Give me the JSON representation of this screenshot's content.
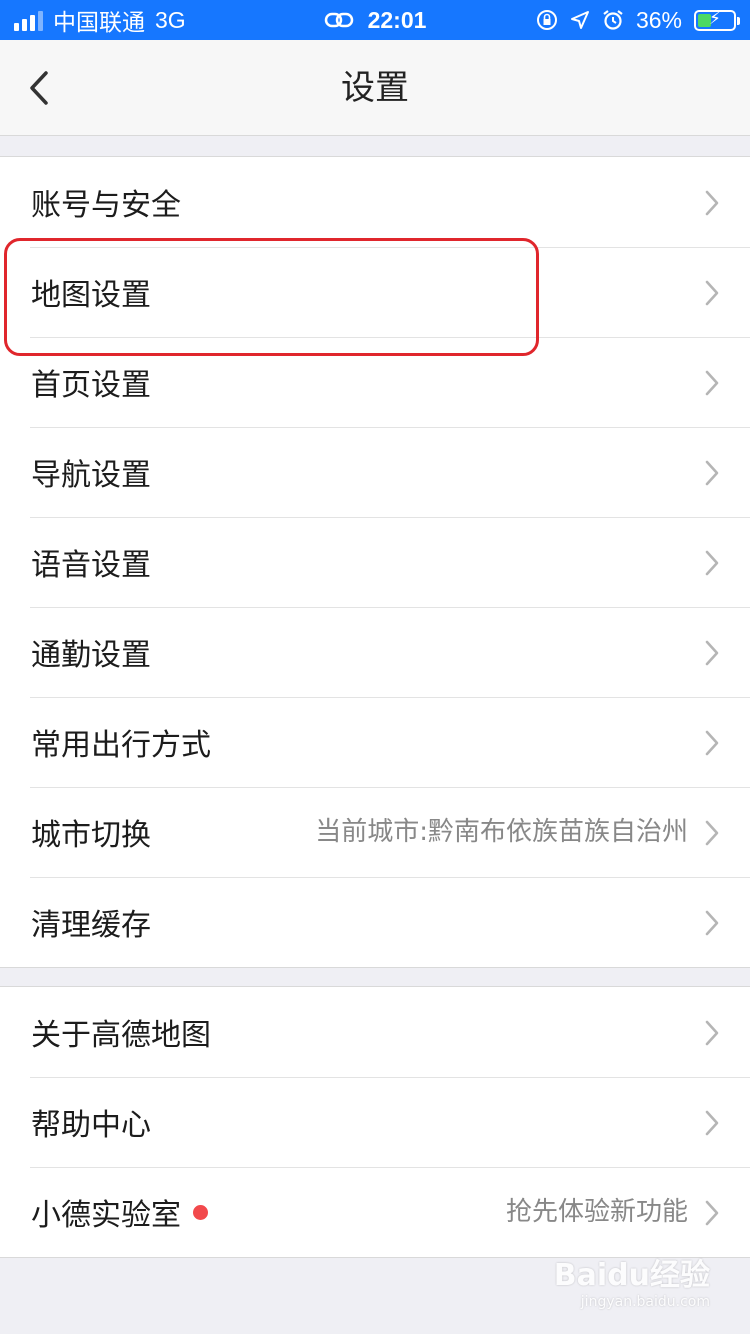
{
  "status_bar": {
    "carrier": "中国联通",
    "network": "3G",
    "time": "22:01",
    "battery": "36%",
    "battery_level": 0.36
  },
  "nav": {
    "title": "设置",
    "back_icon": "chevron-left-icon"
  },
  "group1": [
    {
      "label": "账号与安全",
      "value": ""
    },
    {
      "label": "地图设置",
      "value": ""
    },
    {
      "label": "首页设置",
      "value": ""
    },
    {
      "label": "导航设置",
      "value": ""
    },
    {
      "label": "语音设置",
      "value": ""
    },
    {
      "label": "通勤设置",
      "value": ""
    },
    {
      "label": "常用出行方式",
      "value": ""
    },
    {
      "label": "城市切换",
      "value": "当前城市:黔南布依族苗族自治州"
    },
    {
      "label": "清理缓存",
      "value": ""
    }
  ],
  "group2": [
    {
      "label": "关于高德地图",
      "value": ""
    },
    {
      "label": "帮助中心",
      "value": ""
    },
    {
      "label": "小德实验室",
      "value": "抢先体验新功能",
      "badge": true
    }
  ],
  "colors": {
    "status_bar": "#1677ff",
    "highlight": "#e0262c",
    "badge": "#f2494c"
  },
  "watermark": {
    "brand": "Baidu经验",
    "url": "jingyan.baidu.com"
  }
}
